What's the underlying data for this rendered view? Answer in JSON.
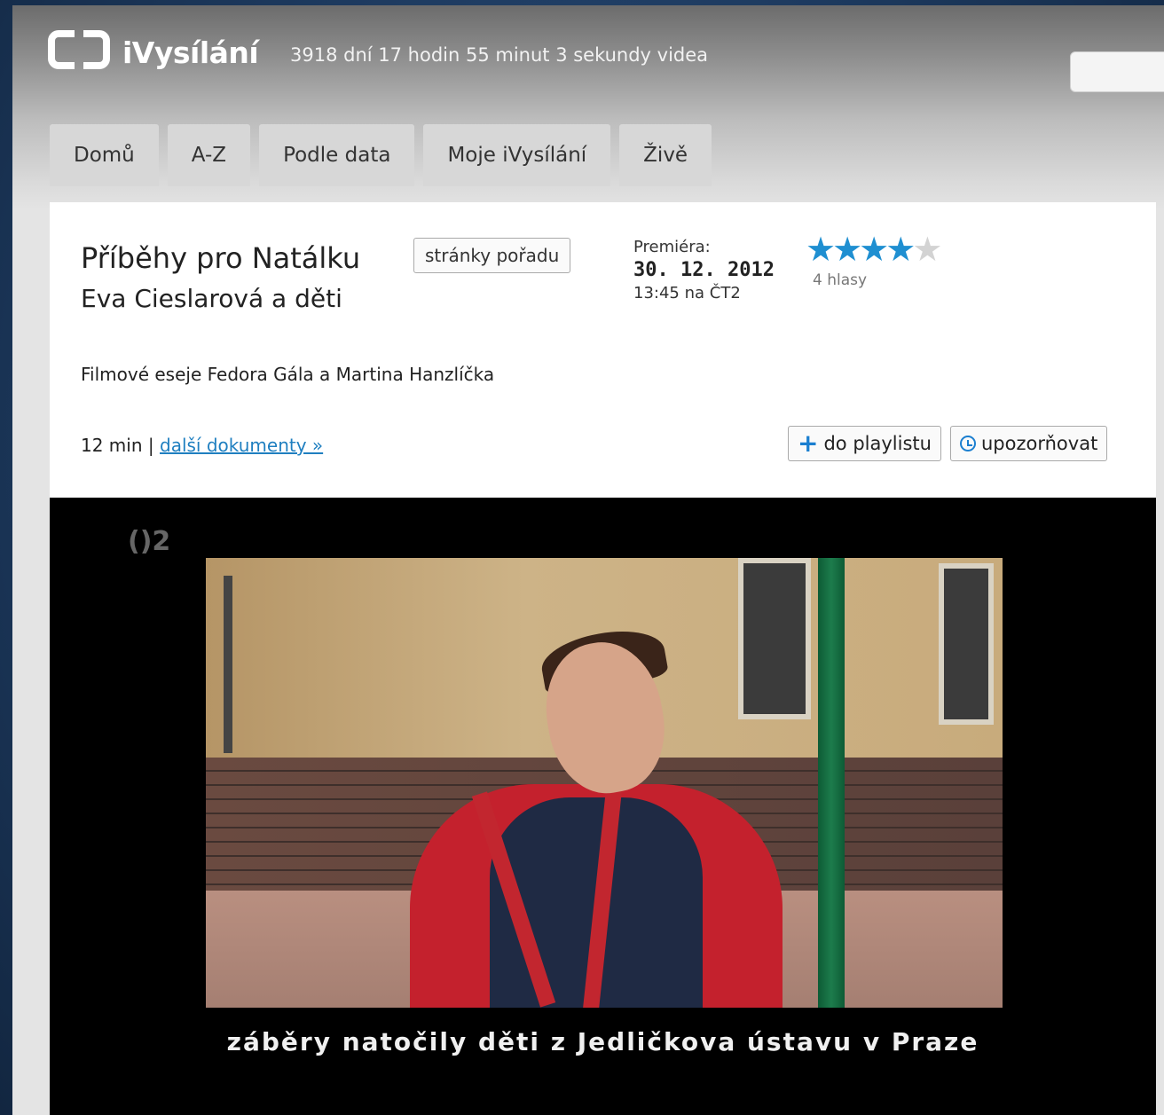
{
  "header": {
    "logo_text": "iVysílání",
    "counter": "3918 dní 17 hodin 55 minut 3 sekundy videa"
  },
  "nav": {
    "tabs": [
      "Domů",
      "A-Z",
      "Podle data",
      "Moje iVysílání",
      "Živě"
    ]
  },
  "program": {
    "title": "Příběhy pro Natálku",
    "subtitle": "Eva Cieslarová a děti",
    "show_page_button": "stránky pořadu",
    "premiere_label": "Premiéra:",
    "premiere_date": "30. 12. 2012",
    "premiere_time": "13:45 na ČT2",
    "rating": {
      "value": 4,
      "max": 5,
      "votes": "4 hlasy"
    },
    "description": "Filmové eseje Fedora Gála a Martina Hanzlíčka",
    "duration": "12 min",
    "separator": "|",
    "more_link": "další dokumenty »",
    "playlist_button": "do playlistu",
    "notify_button": "upozorňovat"
  },
  "video": {
    "channel_logo": "()2",
    "subtitle_text": "záběry natočily děti z Jedličkova ústavu v Praze"
  },
  "colors": {
    "accent": "#1f8fd1",
    "link": "#1f7fc0"
  }
}
